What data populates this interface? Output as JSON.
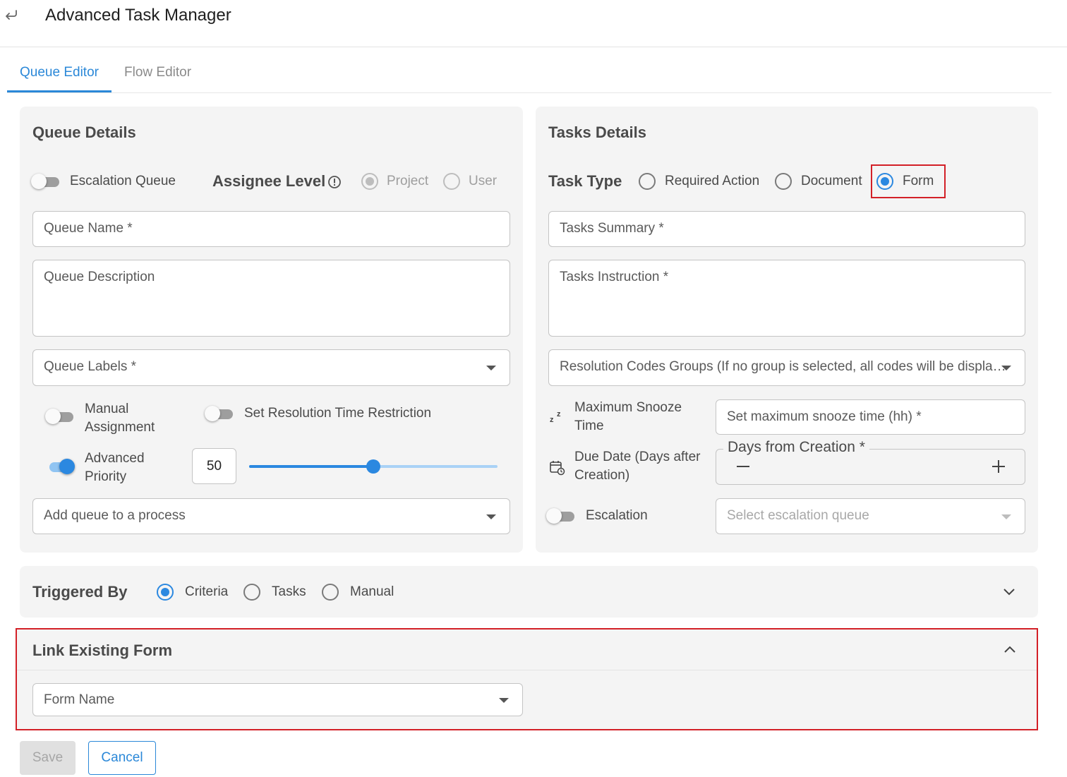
{
  "header": {
    "title": "Advanced Task Manager"
  },
  "tabs": [
    {
      "label": "Queue Editor",
      "active": true
    },
    {
      "label": "Flow Editor",
      "active": false
    }
  ],
  "queue_details": {
    "title": "Queue Details",
    "escalation_queue_label": "Escalation Queue",
    "escalation_queue_on": false,
    "assignee_level_label": "Assignee Level",
    "assignee_options": [
      "Project",
      "User"
    ],
    "assignee_selected": "Project",
    "queue_name_placeholder": "Queue Name *",
    "queue_description_placeholder": "Queue Description",
    "queue_labels_placeholder": "Queue Labels *",
    "manual_assignment_line1": "Manual",
    "manual_assignment_line2": "Assignment",
    "manual_assignment_on": false,
    "resolution_time_label": "Set Resolution Time Restriction",
    "resolution_time_on": false,
    "advanced_priority_line1": "Advanced",
    "advanced_priority_line2": "Priority",
    "advanced_priority_on": true,
    "priority_value": "50",
    "priority_slider_percent": 50,
    "add_process_placeholder": "Add queue to a process"
  },
  "tasks_details": {
    "title": "Tasks Details",
    "task_type_label": "Task Type",
    "task_type_options": [
      "Required Action",
      "Document",
      "Form"
    ],
    "task_type_selected": "Form",
    "tasks_summary_placeholder": "Tasks Summary *",
    "tasks_instruction_placeholder": "Tasks Instruction *",
    "resolution_codes_placeholder": "Resolution Codes Groups (If no group is selected, all codes will be displa…",
    "max_snooze_line1": "Maximum Snooze",
    "max_snooze_line2": "Time",
    "max_snooze_placeholder": "Set maximum snooze time (hh) *",
    "due_date_line1": "Due Date (Days after",
    "due_date_line2": "Creation)",
    "days_from_creation_label": "Days from Creation *",
    "escalation_label": "Escalation",
    "escalation_on": false,
    "escalation_queue_placeholder": "Select escalation queue"
  },
  "triggered_by": {
    "title": "Triggered By",
    "options": [
      "Criteria",
      "Tasks",
      "Manual"
    ],
    "selected": "Criteria"
  },
  "link_form": {
    "title": "Link Existing Form",
    "form_name_placeholder": "Form Name"
  },
  "actions": {
    "save_label": "Save",
    "cancel_label": "Cancel"
  },
  "icons": {
    "back": "back-arrow-icon",
    "info": "info-icon",
    "snooze": "snooze-icon",
    "calendar": "calendar-icon",
    "chevron_down": "chevron-down-icon",
    "chevron_up": "chevron-up-icon",
    "minus": "minus-icon",
    "plus": "plus-icon"
  },
  "colors": {
    "accent": "#2b88e0",
    "highlight_border": "#d32027",
    "panel_bg": "#f4f4f4"
  }
}
